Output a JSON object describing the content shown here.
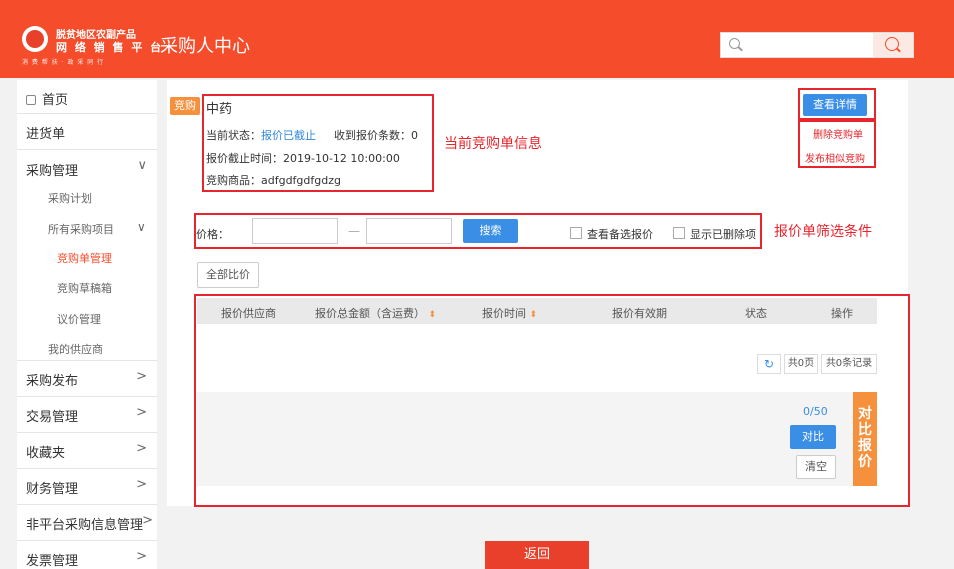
{
  "header": {
    "logo_line1": "脱贫地区农副产品",
    "logo_line2": "网 络 销 售 平 台",
    "logo_line3": "消 费 帮 扶 · 政 采 同 行",
    "title": "采购人中心",
    "search_placeholder": ""
  },
  "sidebar": {
    "items": [
      {
        "label": "首页",
        "arrow": ""
      },
      {
        "label": "进货单",
        "arrow": ""
      },
      {
        "label": "采购管理",
        "arrow": "∨"
      },
      {
        "label": "采购发布",
        "arrow": ">"
      },
      {
        "label": "交易管理",
        "arrow": ">"
      },
      {
        "label": "收藏夹",
        "arrow": ">"
      },
      {
        "label": "财务管理",
        "arrow": ">"
      },
      {
        "label": "非平台采购信息管理",
        "arrow": ">"
      },
      {
        "label": "发票管理",
        "arrow": ">"
      }
    ],
    "sub": {
      "plan": "采购计划",
      "projects": "所有采购项目",
      "projects_arrow": "∨",
      "bid_mgmt": "竞购单管理",
      "bid_draft": "竞购草稿箱",
      "negotiation": "议价管理",
      "suppliers": "我的供应商"
    }
  },
  "bid": {
    "tag": "竞购",
    "title": "中药",
    "status_label": "当前状态：",
    "status_value": "报价已截止",
    "received_label": "收到报价条数：",
    "received_value": "0",
    "deadline": "报价截止时间：2019-10-12 10:00:00",
    "product": "竞购商品：adfgdfgdfgdzg",
    "view_detail": "查看详情",
    "delete": "删除竞购单",
    "publish_similar": "发布相似竞购"
  },
  "annotations": {
    "info": "当前竞购单信息",
    "filter": "报价单筛选条件"
  },
  "filter": {
    "price_label": "价格：",
    "dash": "—",
    "search": "搜索",
    "show_backup": "查看备选报价",
    "show_deleted": "显示已删除项"
  },
  "compare_all": "全部比价",
  "table": {
    "headers": [
      "报价供应商",
      "报价总金额（含运费）",
      "报价时间",
      "报价有效期",
      "状态",
      "操作"
    ],
    "sort_glyph": "⬍"
  },
  "pager": {
    "refresh_glyph": "↻",
    "pages": "共0页",
    "records": "共0条记录"
  },
  "compare": {
    "count": "0/50",
    "compare": "对比",
    "clear": "清空",
    "tab": [
      "对",
      "比",
      "报",
      "价"
    ]
  },
  "return": "返回",
  "colors": {
    "brand": "#f54d2c",
    "annotation": "#e7252c",
    "primary": "#3a8ee6",
    "accent": "#f5903d"
  }
}
